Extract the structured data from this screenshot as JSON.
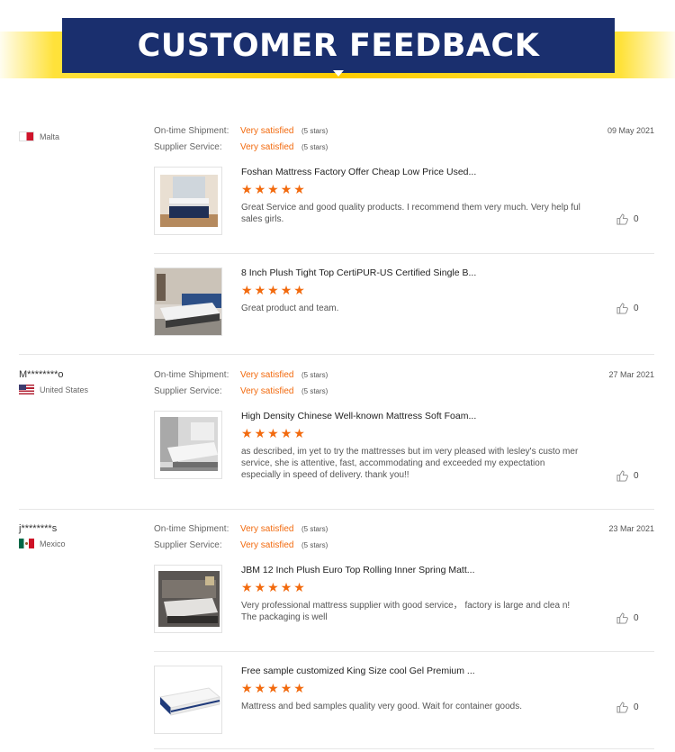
{
  "banner": {
    "title": "CUSTOMER FEEDBACK"
  },
  "reviews": [
    {
      "name": "",
      "country": "Malta",
      "date": "09 May 2021",
      "shipment_label": "On-time Shipment:",
      "shipment_value": "Very satisfied",
      "shipment_stars": "(5 stars)",
      "service_label": "Supplier Service:",
      "service_value": "Very satisfied",
      "service_stars": "(5 stars)",
      "products": [
        {
          "title": "Foshan Mattress Factory Offer Cheap Low Price Used...",
          "rating": 5,
          "comment": "Great Service and good quality products. I recommend them very much. Very help ful sales girls.",
          "likes": "0"
        },
        {
          "title": "8 Inch Plush Tight Top CertiPUR-US Certified Single B...",
          "rating": 5,
          "comment": "Great product and team.",
          "likes": "0"
        }
      ]
    },
    {
      "name": "M********o",
      "country": "United States",
      "date": "27 Mar 2021",
      "shipment_label": "On-time Shipment:",
      "shipment_value": "Very satisfied",
      "shipment_stars": "(5 stars)",
      "service_label": "Supplier Service:",
      "service_value": "Very satisfied",
      "service_stars": "(5 stars)",
      "products": [
        {
          "title": "High Density Chinese Well-known Mattress Soft Foam...",
          "rating": 5,
          "comment": "as described, im yet to try the mattresses but im very pleased with lesley's custo mer service, she is attentive, fast, accommodating and exceeded my expectation especially in speed of delivery. thank you!!",
          "likes": "0"
        }
      ]
    },
    {
      "name": "j********s",
      "country": "Mexico",
      "date": "23 Mar 2021",
      "shipment_label": "On-time Shipment:",
      "shipment_value": "Very satisfied",
      "shipment_stars": "(5 stars)",
      "service_label": "Supplier Service:",
      "service_value": "Very satisfied",
      "service_stars": "(5 stars)",
      "products": [
        {
          "title": "JBM 12 Inch Plush Euro Top Rolling Inner Spring Matt...",
          "rating": 5,
          "comment": "Very professional mattress supplier with good service，  factory is large and clea n!  The packaging is well",
          "likes": "0"
        },
        {
          "title": "Free sample customized King Size cool Gel Premium ...",
          "rating": 5,
          "comment": "Mattress and bed samples quality very good. Wait for container goods.",
          "likes": "0"
        }
      ]
    }
  ],
  "colors": {
    "banner_bg": "#1a2f6e",
    "banner_stripe": "#ffcc00",
    "accent": "#f26a0e"
  }
}
